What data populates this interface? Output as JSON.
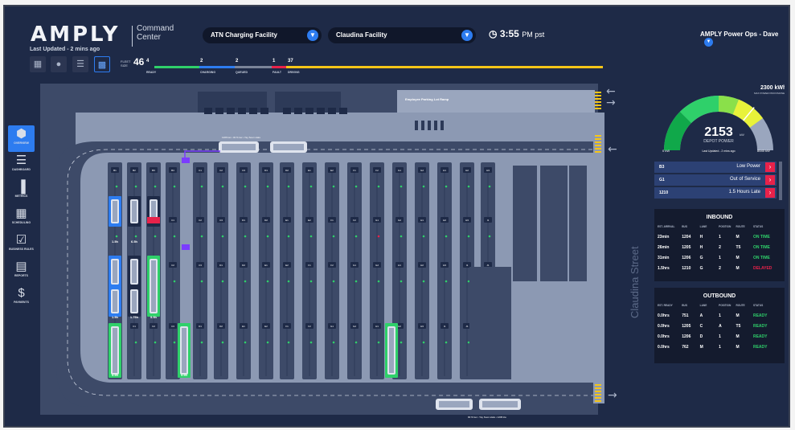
{
  "app": {
    "logo": "AMPLY",
    "subtitle": "Command Center",
    "last_updated": "Last Updated - 2 mins ago"
  },
  "header": {
    "facility_left": "ATN Charging Facility",
    "facility_right": "Claudina Facility",
    "time": "3:55",
    "time_suffix": "PM pst",
    "user": "AMPLY Power Ops - Dave"
  },
  "fleet": {
    "label": "FLEET SIZE",
    "size": "46",
    "stats": [
      {
        "value": "4",
        "label": "READY",
        "color": "#2fd06a"
      },
      {
        "value": "2",
        "label": "CHARGING",
        "color": "#2d7cf0"
      },
      {
        "value": "2",
        "label": "QUEUED",
        "color": "#7a8499"
      },
      {
        "value": "1",
        "label": "FAULT",
        "color": "#e8224a"
      },
      {
        "value": "37",
        "label": "DRIVING",
        "color": "#f5c518"
      }
    ]
  },
  "view_toggles": [
    "grid-view",
    "map-view",
    "list-view",
    "bus-view"
  ],
  "sidebar": [
    {
      "label": "OVERVIEW",
      "icon": "hexagon-icon",
      "active": true
    },
    {
      "label": "DASHBOARD",
      "icon": "dashboard-icon",
      "active": false
    },
    {
      "label": "METRICS",
      "icon": "bar-chart-icon",
      "active": false
    },
    {
      "label": "SCHEDULING",
      "icon": "calendar-icon",
      "active": false
    },
    {
      "label": "BUSINESS RULES",
      "icon": "clipboard-icon",
      "active": false
    },
    {
      "label": "REPORTS",
      "icon": "report-icon",
      "active": false
    },
    {
      "label": "PAYMENTS",
      "icon": "dollar-icon",
      "active": false
    }
  ],
  "map": {
    "parking_label": "Employee Parking Lot Ramp",
    "street_label": "Claudina Street",
    "bus_top_caption": "1206 kw • 32 % kw • Yay Soon stats",
    "bus_bottom_caption": "90 % kw • Yay Soon stats • 1206 kw",
    "lane_codes": [
      "B1",
      "B2",
      "B3",
      "B4",
      "C1",
      "C2",
      "C3",
      "D1",
      "D2",
      "E1",
      "E2",
      "F1",
      "F2",
      "G1",
      "G2",
      "H1",
      "H2",
      "H3",
      "I1",
      "J1",
      "K1",
      "K2"
    ],
    "bay_values": [
      "1.5h",
      "6.5h",
      "1.5h",
      "1.75h",
      "5.5h",
      "5.5h",
      "5.5h"
    ]
  },
  "gauge": {
    "max_value": "2300",
    "max_unit": "kWh",
    "max_label": "MAX POWER PROVISIONED",
    "value": "2153",
    "unit": "kW",
    "label": "DEPOT POWER",
    "min": "0",
    "min_unit": "kW",
    "end": "8545",
    "end_unit": "kW",
    "last_updated": "Last Updated - 2 mins ago",
    "fill": 0.8
  },
  "alerts": [
    {
      "id": "B3",
      "text": "Low Power"
    },
    {
      "id": "G1",
      "text": "Out of Service"
    },
    {
      "id": "1210",
      "text": "1.5 Hours Late"
    }
  ],
  "inbound": {
    "title": "INBOUND",
    "headers": [
      "EST. ARRIVAL",
      "BUS",
      "LANE",
      "POSITION",
      "ROUTE",
      "STATUS"
    ],
    "rows": [
      [
        "23min",
        "1204",
        "H",
        "1",
        "M",
        "ON TIME"
      ],
      [
        "26min",
        "1205",
        "H",
        "2",
        "T5",
        "ON TIME"
      ],
      [
        "31min",
        "1206",
        "G",
        "1",
        "M",
        "ON TIME"
      ],
      [
        "1.5hrs",
        "1210",
        "G",
        "2",
        "M",
        "DELAYED"
      ]
    ]
  },
  "outbound": {
    "title": "OUTBOUND",
    "headers": [
      "EST. READY",
      "BUS",
      "LANE",
      "POSITION",
      "ROUTE",
      "STATUS"
    ],
    "rows": [
      [
        "0.0hrs",
        "751",
        "A",
        "1",
        "M",
        "READY"
      ],
      [
        "0.0hrs",
        "1205",
        "C",
        "A",
        "T5",
        "READY"
      ],
      [
        "0.0hrs",
        "1206",
        "D",
        "1",
        "M",
        "READY"
      ],
      [
        "0.0hrs",
        "762",
        "M",
        "1",
        "M",
        "READY"
      ]
    ]
  }
}
